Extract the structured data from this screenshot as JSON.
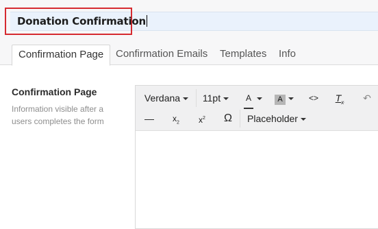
{
  "header": {
    "title_value": "Donation Confirmation"
  },
  "tabs": [
    {
      "label": "Confirmation Page",
      "active": true
    },
    {
      "label": "Confirmation Emails",
      "active": false
    },
    {
      "label": "Templates",
      "active": false
    },
    {
      "label": "Info",
      "active": false
    }
  ],
  "section": {
    "title": "Confirmation Page",
    "description": "Information visible after a users completes the form"
  },
  "editor": {
    "toolbar": {
      "font_family": "Verdana",
      "font_size": "11pt",
      "text_color_glyph": "A",
      "background_color_glyph": "A",
      "code_view_glyph": "<>",
      "clear_format_glyph": "T",
      "clear_format_sub": "x",
      "undo_glyph": "↶",
      "horizontal_rule_glyph": "—",
      "subscript_glyph": "x",
      "subscript_sub": "2",
      "superscript_glyph": "x",
      "superscript_sup": "2",
      "special_char_glyph": "Ω",
      "placeholder_label": "Placeholder"
    },
    "content": ""
  },
  "colors": {
    "highlight_border": "#d62a2f",
    "title_input_bg": "#eaf2fc",
    "toolbar_bg": "#f0f0f1"
  }
}
